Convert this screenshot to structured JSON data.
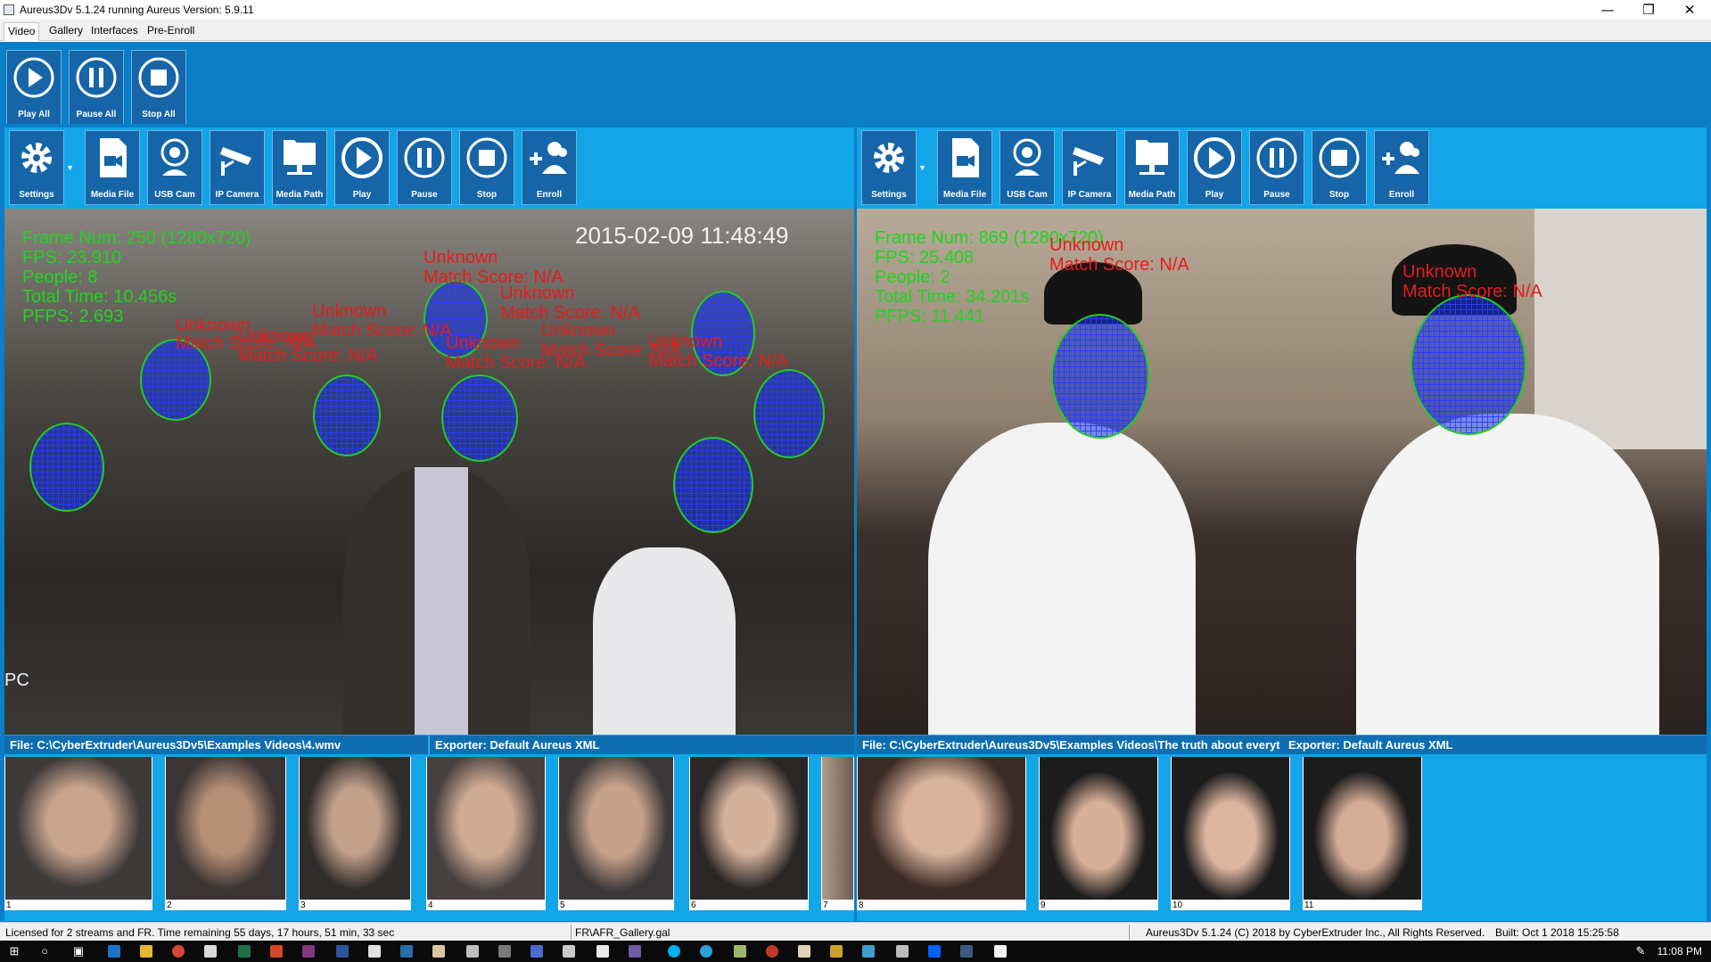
{
  "window": {
    "title": "Aureus3Dv 5.1.24 running Aureus Version: 5.9.11",
    "minimize": "—",
    "restore": "❐",
    "close": "✕"
  },
  "tabs": [
    "Video",
    "Gallery",
    "Interfaces",
    "Pre-Enroll"
  ],
  "global_controls": [
    {
      "label": "Play All",
      "icon": "play-icon"
    },
    {
      "label": "Pause All",
      "icon": "pause-icon"
    },
    {
      "label": "Stop All",
      "icon": "stop-icon"
    }
  ],
  "stream_toolbar": [
    {
      "label": "Settings",
      "icon": "gear-icon"
    },
    {
      "label": "Media File",
      "icon": "media-file-icon"
    },
    {
      "label": "USB Cam",
      "icon": "webcam-icon"
    },
    {
      "label": "IP Camera",
      "icon": "security-camera-icon"
    },
    {
      "label": "Media Path",
      "icon": "monitor-icon"
    },
    {
      "label": "Play",
      "icon": "play-icon"
    },
    {
      "label": "Pause",
      "icon": "pause-icon"
    },
    {
      "label": "Stop",
      "icon": "stop-icon"
    },
    {
      "label": "Enroll",
      "icon": "add-user-icon"
    }
  ],
  "streams": [
    {
      "timestamp": "2015-02-09 11:48:49",
      "side_text": "PC",
      "stats": [
        "Frame Num: 250 (1280x720)",
        "FPS: 23.910",
        "People: 8",
        "Total Time: 10.456s",
        "PFPS: 2.693"
      ],
      "detections": [
        {
          "name": "Unknown",
          "score": "Match Score: N/A"
        },
        {
          "name": "Unknown",
          "score": "Match Score: N/A"
        },
        {
          "name": "Unknown",
          "score": "Match Score: N/A"
        },
        {
          "name": "Unknown",
          "score": "Match Score: N/A"
        },
        {
          "name": "Unknown",
          "score": "Match Score: N/A"
        },
        {
          "name": "Unknown",
          "score": "Match Score: N/A"
        },
        {
          "name": "Unknown",
          "score": "Match Score: N/A"
        },
        {
          "name": "Unknown",
          "score": "Match Score: N/A"
        }
      ],
      "file": "File: C:\\CyberExtruder\\Aureus3Dv5\\Examples Videos\\4.wmv",
      "exporter": "Exporter: Default Aureus XML",
      "thumbnails": [
        "1",
        "2",
        "3",
        "4",
        "5",
        "6",
        "7"
      ]
    },
    {
      "stats": [
        "Frame Num: 869 (1280x720)",
        "FPS: 25.408",
        "People: 2",
        "Total Time: 34.201s",
        "PFPS: 11.441"
      ],
      "detections": [
        {
          "name": "Unknown",
          "score": "Match Score: N/A"
        },
        {
          "name": "Unknown",
          "score": "Match Score: N/A"
        }
      ],
      "file": "File: C:\\CyberExtruder\\Aureus3Dv5\\Examples Videos\\The truth about everyt",
      "exporter": "Exporter: Default Aureus XML",
      "thumbnails": [
        "8",
        "9",
        "10",
        "11"
      ]
    }
  ],
  "status": {
    "license": "Licensed for 2 streams and FR. Time remaining 55 days, 17 hours, 51 min, 33 sec",
    "gallery": "FR\\AFR_Gallery.gal",
    "about": "Aureus3Dv 5.1.24 (C) 2018 by CyberExtruder Inc., All Rights Reserved.",
    "built": "Built: Oct 1 2018 15:25:58"
  },
  "taskbar": {
    "time": "11:08 PM"
  }
}
